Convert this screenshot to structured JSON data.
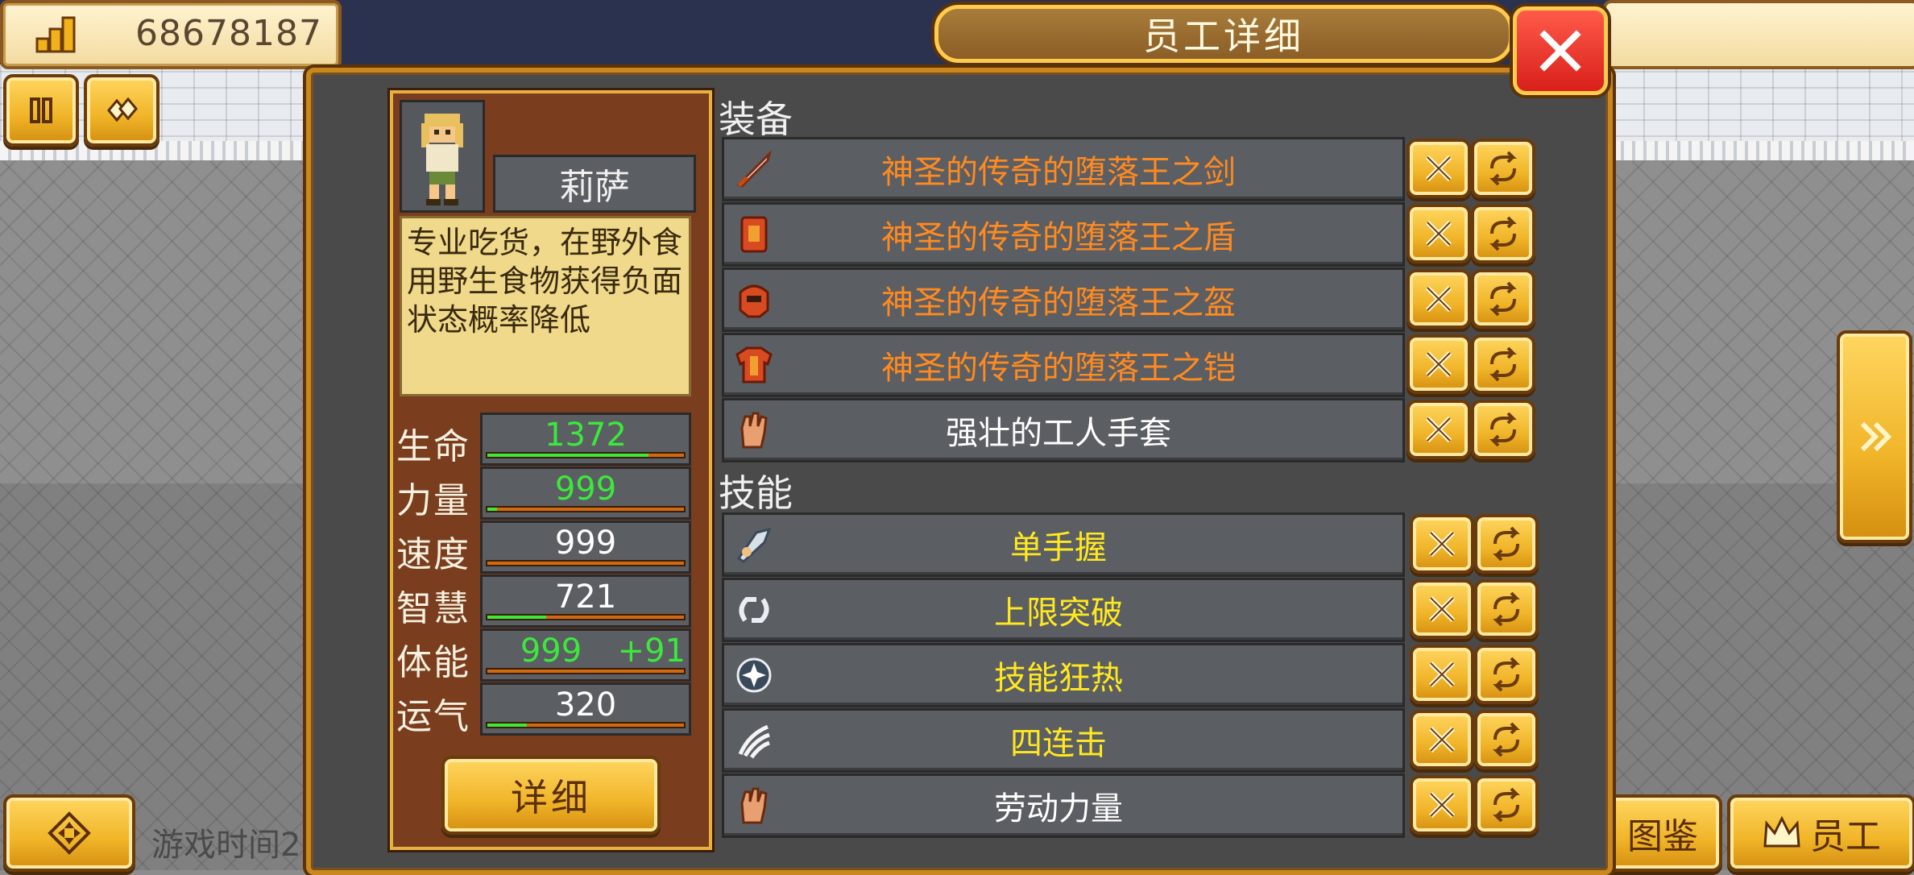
{
  "hud": {
    "gold_amount": "68678187"
  },
  "panel": {
    "title": "员工详细"
  },
  "character": {
    "name": "莉萨",
    "description": "专业吃货，在野外食用野生食物获得负面状态概率降低",
    "stats": [
      {
        "label": "生命",
        "value": "1372",
        "bonus": "",
        "highlight": true,
        "fill": 0.82
      },
      {
        "label": "力量",
        "value": "999",
        "bonus": "",
        "highlight": true,
        "fill": 0.05
      },
      {
        "label": "速度",
        "value": "999",
        "bonus": "",
        "highlight": false,
        "fill": 0.0
      },
      {
        "label": "智慧",
        "value": "721",
        "bonus": "",
        "highlight": false,
        "fill": 0.3
      },
      {
        "label": "体能",
        "value": "999",
        "bonus": "+91",
        "highlight": true,
        "fill": 0.0
      },
      {
        "label": "运气",
        "value": "320",
        "bonus": "",
        "highlight": false,
        "fill": 0.2
      }
    ],
    "detail_button": "详细"
  },
  "equipment": {
    "header": "装备",
    "items": [
      {
        "name": "神圣的传奇的堕落王之剑",
        "icon": "sword-icon",
        "rarity_color": "#ff8a20"
      },
      {
        "name": "神圣的传奇的堕落王之盾",
        "icon": "shield-icon",
        "rarity_color": "#ff8a20"
      },
      {
        "name": "神圣的传奇的堕落王之盔",
        "icon": "helmet-icon",
        "rarity_color": "#ff8a20"
      },
      {
        "name": "神圣的传奇的堕落王之铠",
        "icon": "armor-icon",
        "rarity_color": "#ff8a20"
      },
      {
        "name": "强壮的工人手套",
        "icon": "glove-icon",
        "rarity_color": "#ffffff"
      }
    ]
  },
  "skills": {
    "header": "技能",
    "items": [
      {
        "name": "单手握",
        "icon": "grip-icon"
      },
      {
        "name": "上限突破",
        "icon": "limit-break-icon"
      },
      {
        "name": "技能狂热",
        "icon": "orb-icon"
      },
      {
        "name": "四连击",
        "icon": "claw-icon"
      },
      {
        "name": "劳动力量",
        "icon": "glove-icon"
      }
    ]
  },
  "bottom_bar": {
    "time_label": "游戏时间2",
    "encyclopedia_label": "图鉴",
    "staff_label": "员工"
  }
}
